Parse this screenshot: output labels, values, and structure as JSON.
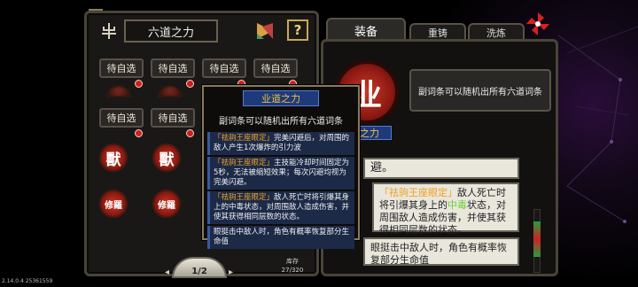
{
  "left_panel": {
    "title": "六道之力",
    "help_label": "?",
    "slot_label": "待自选",
    "slot_count": 12,
    "seals": [
      "獸",
      "獸",
      "修羅",
      "修羅"
    ],
    "fan_label": "1/2",
    "inventory_label": "库存",
    "inventory_value": "27/320"
  },
  "tabs": [
    {
      "label": "装备",
      "active": true
    },
    {
      "label": "重铸",
      "active": false
    },
    {
      "label": "洗炼",
      "active": false
    }
  ],
  "right_panel": {
    "seal_glyph": "业",
    "desc": "副词条可以随机出所有六道词条",
    "section_title": "业道之力",
    "affix_tail": "避。",
    "affix1_tag": "「祛驹王座眼定」",
    "affix1_a": "敌人死亡时",
    "affix1_b": "将引爆其身上的",
    "affix1_poison": "中毒",
    "affix1_c": "状态，对周围敌人造成伤害，并使其获得相同层数的状态。",
    "affix2": "眼挺击中敌人时，角色有概率恢复部分生命值"
  },
  "tooltip": {
    "title": "业道之力",
    "subtitle": "副词条可以随机出所有六道词条",
    "rows": [
      {
        "tag": "「祛驹王座眼定」",
        "text": "完美闪避后，对周围的敌人产生1次爆炸的引力波"
      },
      {
        "tag": "「祛驹王座眼定」",
        "text": "主技能冷却时间固定为5秒，无法被缩短效果；每次闪避均视为完美闪避。"
      },
      {
        "tag": "「祛驹王座眼定」",
        "text": "敌人死亡时将引爆其身上的中毒状态，对周围敌人造成伤害，并使其获得相同层数的状态。"
      },
      {
        "tag": "",
        "text": "眼挺击中敌人时，角色有概率恢复部分生命值"
      }
    ]
  },
  "version": "2.14.0.4 25361559",
  "colors": {
    "seal_red": "#c73a28",
    "poison_green": "#6ad23c",
    "tag_orange": "#f0a020",
    "tip_blue": "#1c2a48"
  }
}
